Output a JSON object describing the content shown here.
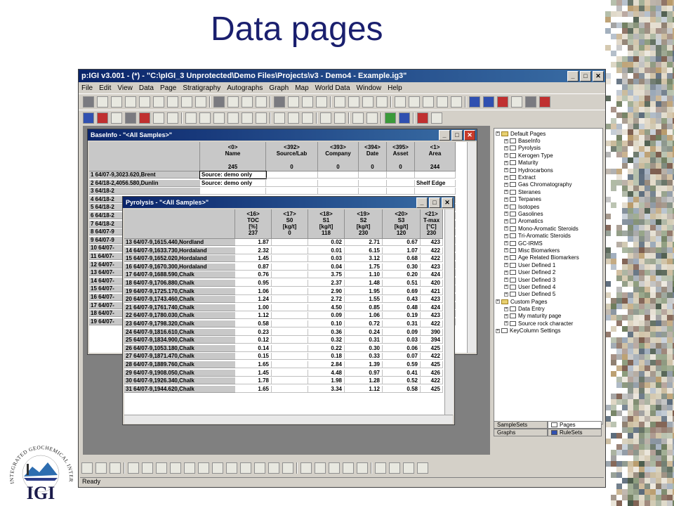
{
  "slide": {
    "title": "Data pages"
  },
  "app": {
    "title": "p:IGI v3.001 - (*) - \"C:\\pIGI_3 Unprotected\\Demo Files\\Projects\\v3 - Demo4 - Example.ig3\"",
    "menu": [
      "File",
      "Edit",
      "View",
      "Data",
      "Page",
      "Stratigraphy",
      "Autographs",
      "Graph",
      "Map",
      "World Data",
      "Window",
      "Help"
    ],
    "status": "Ready"
  },
  "tree": {
    "default_label": "Default Pages",
    "default_items": [
      "BaseInfo",
      "Pyrolysis",
      "Kerogen Type",
      "Maturity",
      "Hydrocarbons",
      "Extract",
      "Gas Chromatography",
      "Steranes",
      "Terpanes",
      "Isotopes",
      "Gasolines",
      "Aromatics",
      "Mono-Aromatic Steroids",
      "Tri-Aromatic Steroids",
      "GC-IRMS",
      "Misc Biomarkers",
      "Age Related Biomarkers",
      "User Defined 1",
      "User Defined 2",
      "User Defined 3",
      "User Defined 4",
      "User Defined 5"
    ],
    "custom_label": "Custom Pages",
    "custom_items": [
      "Data Entry",
      "My maturity page",
      "Source rock character"
    ],
    "keycol": "KeyColumn Settings"
  },
  "panel_tabs": {
    "samplesets": "SampleSets",
    "pages": "Pages",
    "graphs": "Graphs",
    "rulesets": "RuleSets"
  },
  "baseinfo": {
    "title": "BaseInfo - \"<All Samples>\"",
    "columns": [
      {
        "code": "<0>",
        "name": "Name",
        "count": "245"
      },
      {
        "code": "<392>",
        "name": "Source/Lab",
        "count": "0"
      },
      {
        "code": "<393>",
        "name": "Company",
        "count": "0"
      },
      {
        "code": "<394>",
        "name": "Date",
        "count": "0"
      },
      {
        "code": "<395>",
        "name": "Asset",
        "count": "0"
      },
      {
        "code": "<1>",
        "name": "Area",
        "count": "244"
      }
    ],
    "rows": [
      {
        "label": "1 64/07-9,3023.620,Brent",
        "name": "Source: demo only",
        "area": ""
      },
      {
        "label": "2 64/18-2,4056.580,Dunlin",
        "name": "Source: demo only",
        "area": "Shelf Edge"
      },
      {
        "label": "3 64/18-2",
        "name": "",
        "area": ""
      },
      {
        "label": "4 64/18-2",
        "name": "",
        "area": ""
      },
      {
        "label": "5 64/18-2",
        "name": "",
        "area": ""
      },
      {
        "label": "6 64/18-2",
        "name": "",
        "area": ""
      },
      {
        "label": "7 64/18-2",
        "name": "",
        "area": ""
      },
      {
        "label": "8 64/07-9",
        "name": "",
        "area": ""
      },
      {
        "label": "9 64/07-9",
        "name": "",
        "area": ""
      },
      {
        "label": "10 64/07-",
        "name": "",
        "area": ""
      },
      {
        "label": "11 64/07-",
        "name": "",
        "area": ""
      },
      {
        "label": "12 64/07-",
        "name": "",
        "area": ""
      },
      {
        "label": "13 64/07-",
        "name": "",
        "area": ""
      },
      {
        "label": "14 64/07-",
        "name": "",
        "area": ""
      },
      {
        "label": "15 64/07-",
        "name": "",
        "area": ""
      },
      {
        "label": "16 64/07-",
        "name": "",
        "area": ""
      },
      {
        "label": "17 64/07-",
        "name": "",
        "area": ""
      },
      {
        "label": "18 64/07-",
        "name": "",
        "area": ""
      },
      {
        "label": "19 64/07-",
        "name": "",
        "area": ""
      }
    ]
  },
  "pyrolysis": {
    "title": "Pyrolysis - \"<All Samples>\"",
    "columns": [
      {
        "code": "<16>",
        "name": "TOC",
        "unit": "[%]",
        "count": "237"
      },
      {
        "code": "<17>",
        "name": "S0",
        "unit": "[kg/t]",
        "count": "0"
      },
      {
        "code": "<18>",
        "name": "S1",
        "unit": "[kg/t]",
        "count": "118"
      },
      {
        "code": "<19>",
        "name": "S2",
        "unit": "[kg/t]",
        "count": "230"
      },
      {
        "code": "<20>",
        "name": "S3",
        "unit": "[kg/t]",
        "count": "120"
      },
      {
        "code": "<21>",
        "name": "T-max",
        "unit": "[°C]",
        "count": "230"
      }
    ],
    "rows": [
      {
        "label": "13 64/07-9,1615.440,Nordland",
        "v": [
          "1.87",
          "",
          "0.02",
          "2.71",
          "0.67",
          "423"
        ]
      },
      {
        "label": "14 64/07-9,1633.730,Hordaland",
        "v": [
          "2.32",
          "",
          "0.01",
          "6.15",
          "1.07",
          "422"
        ]
      },
      {
        "label": "15 64/07-9,1652.020,Hordaland",
        "v": [
          "1.45",
          "",
          "0.03",
          "3.12",
          "0.68",
          "422"
        ]
      },
      {
        "label": "16 64/07-9,1670.300,Hordaland",
        "v": [
          "0.87",
          "",
          "0.04",
          "1.75",
          "0.30",
          "423"
        ]
      },
      {
        "label": "17 64/07-9,1688.590,Chalk",
        "v": [
          "0.76",
          "",
          "3.75",
          "1.10",
          "0.20",
          "424"
        ]
      },
      {
        "label": "18 64/07-9,1706.880,Chalk",
        "v": [
          "0.95",
          "",
          "2.37",
          "1.48",
          "0.51",
          "420"
        ]
      },
      {
        "label": "19 64/07-9,1725.170,Chalk",
        "v": [
          "1.06",
          "",
          "2.90",
          "1.95",
          "0.69",
          "421"
        ]
      },
      {
        "label": "20 64/07-9,1743.460,Chalk",
        "v": [
          "1.24",
          "",
          "2.72",
          "1.55",
          "0.43",
          "423"
        ]
      },
      {
        "label": "21 64/07-9,1761.740,Chalk",
        "v": [
          "1.00",
          "",
          "4.50",
          "0.85",
          "0.48",
          "424"
        ]
      },
      {
        "label": "22 64/07-9,1780.030,Chalk",
        "v": [
          "1.12",
          "",
          "0.09",
          "1.06",
          "0.19",
          "423"
        ]
      },
      {
        "label": "23 64/07-9,1798.320,Chalk",
        "v": [
          "0.58",
          "",
          "0.10",
          "0.72",
          "0.31",
          "422"
        ]
      },
      {
        "label": "24 64/07-9,1816.610,Chalk",
        "v": [
          "0.23",
          "",
          "0.36",
          "0.24",
          "0.09",
          "390"
        ]
      },
      {
        "label": "25 64/07-9,1834.900,Chalk",
        "v": [
          "0.12",
          "",
          "0.32",
          "0.31",
          "0.03",
          "394"
        ]
      },
      {
        "label": "26 64/07-9,1053.180,Chalk",
        "v": [
          "0.14",
          "",
          "0.22",
          "0.30",
          "0.06",
          "425"
        ]
      },
      {
        "label": "27 64/07-9,1871.470,Chalk",
        "v": [
          "0.15",
          "",
          "0.18",
          "0.33",
          "0.07",
          "422"
        ]
      },
      {
        "label": "28 64/07-9,1889.760,Chalk",
        "v": [
          "1.65",
          "",
          "2.84",
          "1.39",
          "0.59",
          "425"
        ]
      },
      {
        "label": "29 64/07-9,1908.050,Chalk",
        "v": [
          "1.45",
          "",
          "4.48",
          "0.97",
          "0.41",
          "426"
        ]
      },
      {
        "label": "30 64/07-9,1926.340,Chalk",
        "v": [
          "1.78",
          "",
          "1.98",
          "1.28",
          "0.52",
          "422"
        ]
      },
      {
        "label": "31 64/07-9,1944.620,Chalk",
        "v": [
          "1.65",
          "",
          "3.34",
          "1.12",
          "0.58",
          "425"
        ]
      }
    ]
  },
  "logo": {
    "ring_text": "INTEGRATED GEOCHEMICAL INTERPRETATION",
    "letters": "IGI"
  }
}
